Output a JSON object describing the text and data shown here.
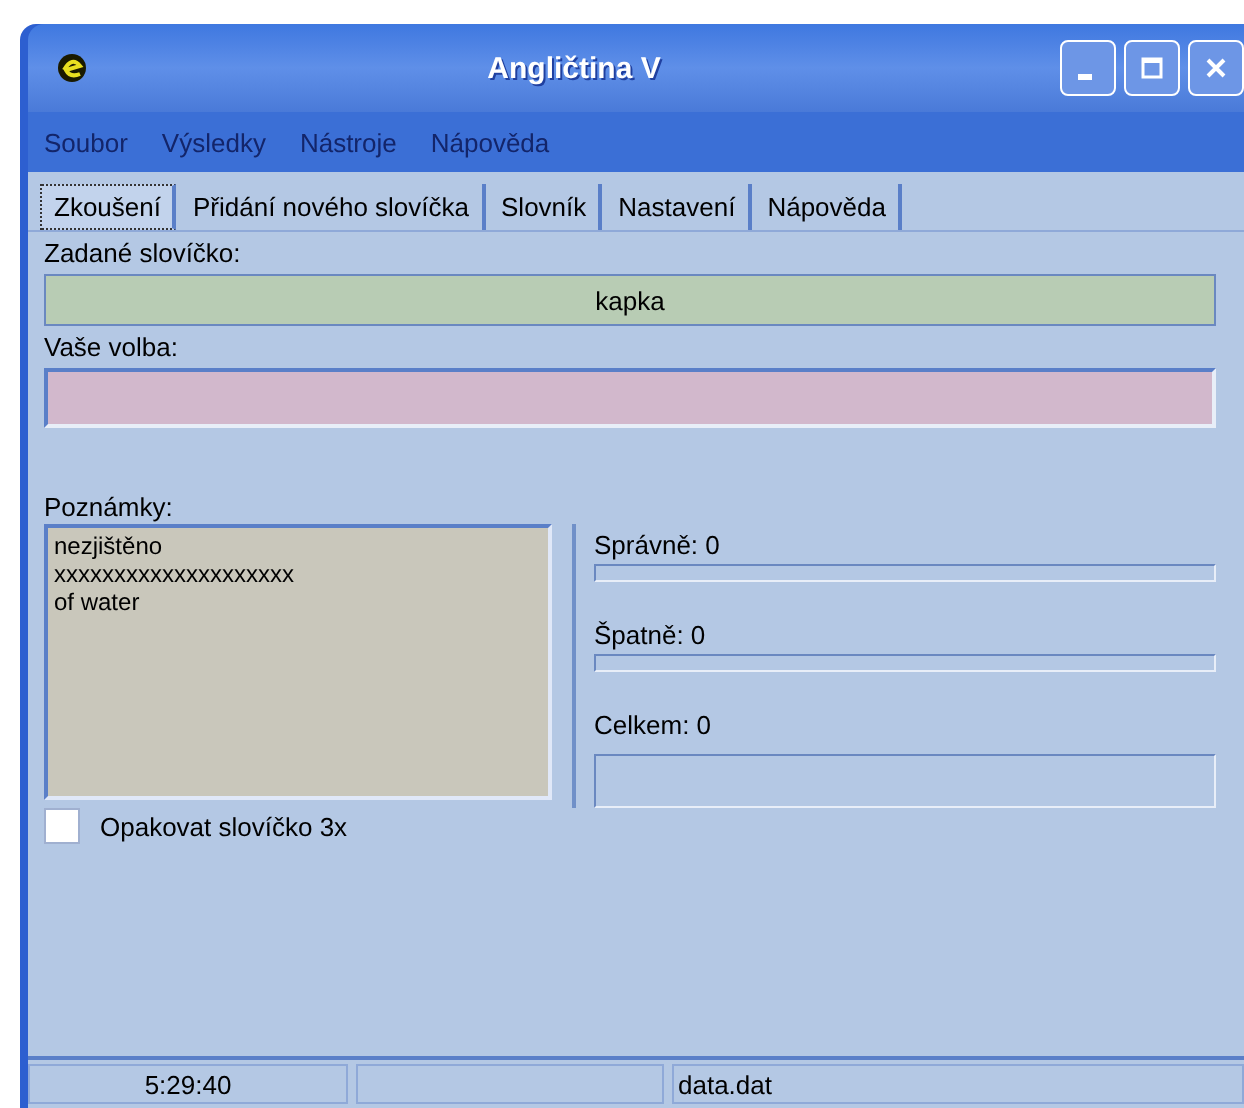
{
  "window": {
    "title": "Angličtina V"
  },
  "menu": [
    "Soubor",
    "Výsledky",
    "Nástroje",
    "Nápověda"
  ],
  "tabs": [
    {
      "label": "Zkoušení",
      "selected": true
    },
    {
      "label": "Přidání nového slovíčka",
      "selected": false
    },
    {
      "label": "Slovník",
      "selected": false
    },
    {
      "label": "Nastavení",
      "selected": false
    },
    {
      "label": "Nápověda",
      "selected": false
    }
  ],
  "given": {
    "label": "Zadané slovíčko:",
    "value": "kapka"
  },
  "answer": {
    "label": "Vaše volba:"
  },
  "notes": {
    "label": "Poznámky:",
    "lines": [
      "nezjištěno",
      "xxxxxxxxxxxxxxxxxxxx",
      "of water"
    ]
  },
  "stats": [
    {
      "kind": "bar",
      "label": "Správně: 0",
      "level": 0
    },
    {
      "kind": "bar",
      "label": "Špatně: 0",
      "level": 0
    },
    {
      "kind": "box",
      "label": "Celkem:  0"
    }
  ],
  "repeat": {
    "label": "Opakovat slovíčko 3x",
    "checked": false
  },
  "status_bar": {
    "time": "5:29:40",
    "file": "data.dat"
  }
}
